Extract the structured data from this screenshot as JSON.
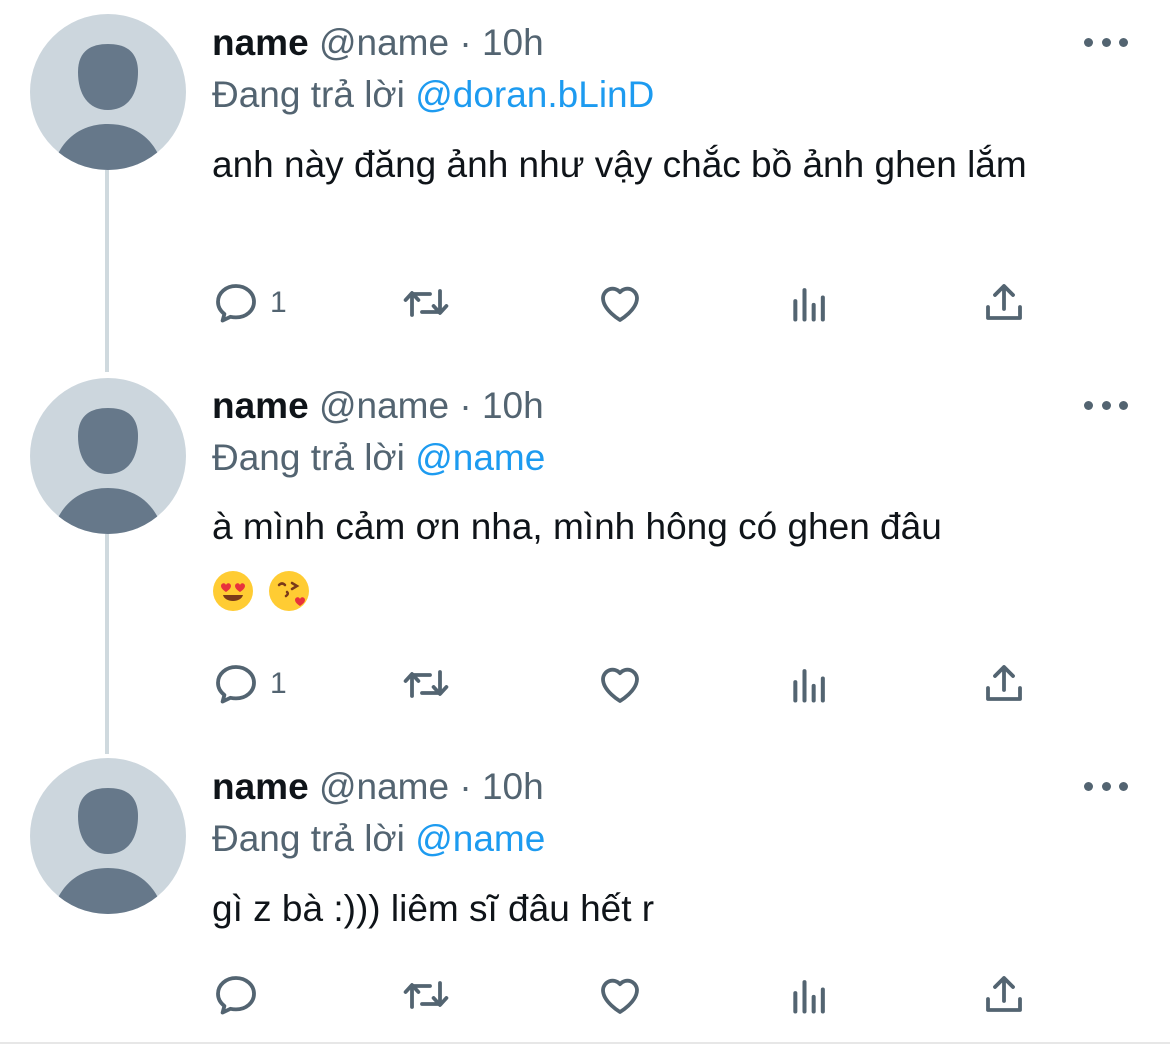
{
  "colors": {
    "accent": "#1d9bf0",
    "muted": "#536471",
    "text": "#0f1419",
    "avatar_bg": "#ccd6dd",
    "avatar_fg": "#66788a"
  },
  "tweets": [
    {
      "display_name": "name",
      "handle": "@name",
      "separator": "·",
      "time": "10h",
      "replying_label": "Đang trả lời",
      "replying_to": "@doran.bLinD",
      "text": "anh này đăng ảnh như vậy chắc bồ ảnh ghen lắm",
      "emojis": [],
      "reply_count": "1",
      "icons": [
        "reply-icon",
        "retweet-icon",
        "like-icon",
        "views-icon",
        "share-icon"
      ]
    },
    {
      "display_name": "name",
      "handle": "@name",
      "separator": "·",
      "time": "10h",
      "replying_label": "Đang trả lời",
      "replying_to": "@name",
      "text": "à mình cảm ơn nha, mình hông có ghen đâu",
      "emojis": [
        "heart-eyes-emoji",
        "kissing-heart-emoji"
      ],
      "reply_count": "1",
      "icons": [
        "reply-icon",
        "retweet-icon",
        "like-icon",
        "views-icon",
        "share-icon"
      ]
    },
    {
      "display_name": "name",
      "handle": "@name",
      "separator": "·",
      "time": "10h",
      "replying_label": "Đang trả lời",
      "replying_to": "@name",
      "text": "gì z bà :))) liêm sĩ đâu hết r",
      "emojis": [],
      "reply_count": "",
      "icons": [
        "reply-icon",
        "retweet-icon",
        "like-icon",
        "views-icon",
        "share-icon"
      ]
    }
  ]
}
